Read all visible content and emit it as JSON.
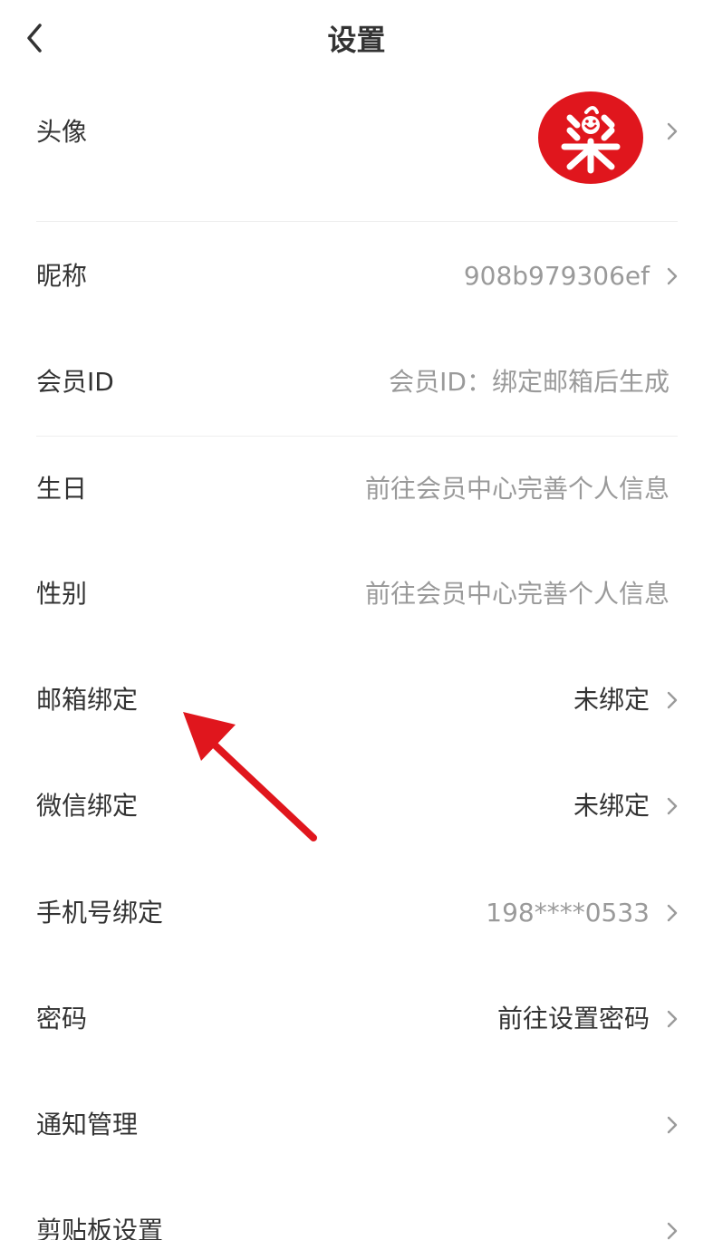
{
  "header": {
    "title": "设置",
    "back_icon": "chevron-left-icon"
  },
  "rows": {
    "avatar": {
      "label": "头像",
      "avatar_glyph": "楽",
      "avatar_color": "#e0161d"
    },
    "nickname": {
      "label": "昵称",
      "value": "908b979306ef"
    },
    "member_id": {
      "label": "会员ID",
      "value": "会员ID：绑定邮箱后生成"
    },
    "birthday": {
      "label": "生日",
      "value": "前往会员中心完善个人信息"
    },
    "gender": {
      "label": "性别",
      "value": "前往会员中心完善个人信息"
    },
    "email": {
      "label": "邮箱绑定",
      "value": "未绑定"
    },
    "wechat": {
      "label": "微信绑定",
      "value": "未绑定"
    },
    "phone": {
      "label": "手机号绑定",
      "value": "198****0533"
    },
    "password": {
      "label": "密码",
      "value": "前往设置密码"
    },
    "notifications": {
      "label": "通知管理"
    },
    "clipboard": {
      "label": "剪贴板设置"
    }
  },
  "colors": {
    "text_primary": "#333333",
    "text_secondary": "#9a9a9a",
    "divider": "#eeeeee",
    "accent_red": "#e0161d",
    "annotation_arrow": "#e0161d"
  }
}
